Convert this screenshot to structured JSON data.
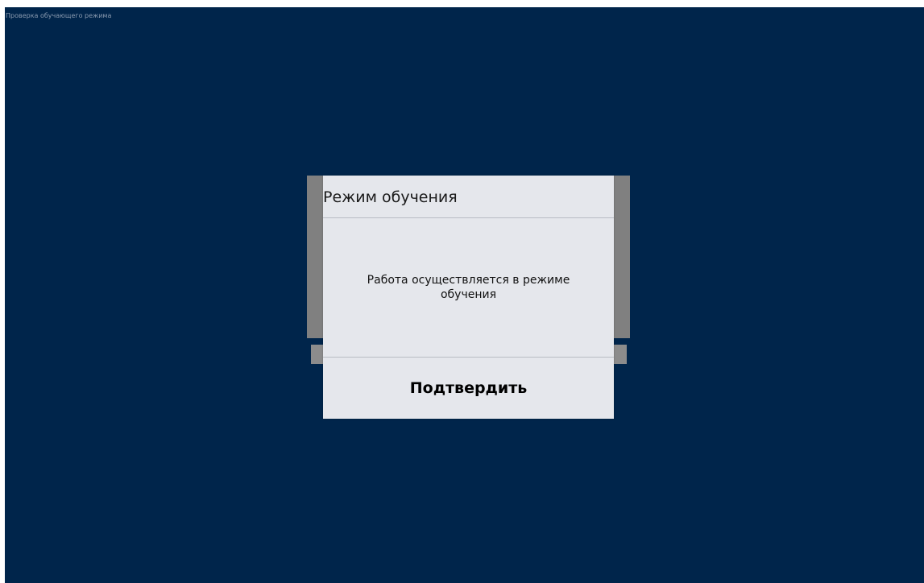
{
  "window": {
    "title": "Проверка обучающего режима",
    "background_color": "#00254b"
  },
  "dialog": {
    "title": "Режим обучения",
    "message": "Работа осуществляется в режиме обучения",
    "confirm_label": "Подтвердить"
  }
}
